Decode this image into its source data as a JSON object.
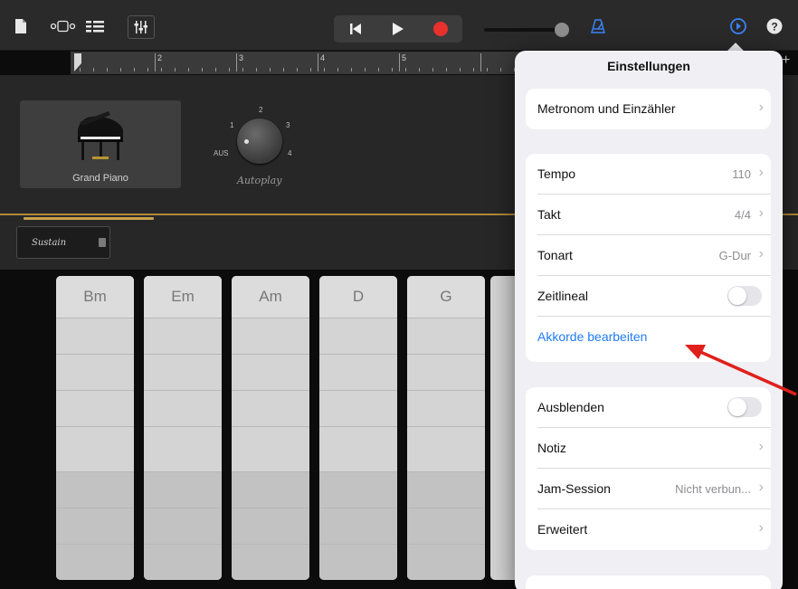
{
  "toolbar": {
    "icons": [
      "document-icon",
      "view-toggle-icon",
      "tracks-view-icon",
      "mixer-icon",
      "rewind-icon",
      "play-icon",
      "record-icon",
      "metronome-icon",
      "settings-icon",
      "help-icon"
    ],
    "accent_color": "#3a82f7",
    "record_color": "#e8302d"
  },
  "ruler": {
    "bars": [
      "2",
      "3",
      "4",
      "5"
    ]
  },
  "track": {
    "instrument_name": "Grand Piano",
    "autoplay_label": "Autoplay",
    "autoplay_positions": [
      "AUS",
      "1",
      "2",
      "3",
      "4"
    ],
    "sustain_label": "Sustain"
  },
  "chords": [
    "Bm",
    "Em",
    "Am",
    "D",
    "G"
  ],
  "settings": {
    "title": "Einstellungen",
    "metronome": "Metronom und Einzähler",
    "tempo_label": "Tempo",
    "tempo_value": "110",
    "takt_label": "Takt",
    "takt_value": "4/4",
    "tonart_label": "Tonart",
    "tonart_value": "G-Dur",
    "zeitlineal_label": "Zeitlineal",
    "zeitlineal_on": false,
    "akkorde_label": "Akkorde bearbeiten",
    "ausblenden_label": "Ausblenden",
    "ausblenden_on": false,
    "notiz_label": "Notiz",
    "jam_label": "Jam-Session",
    "jam_value": "Nicht verbun...",
    "erweitert_label": "Erweitert"
  },
  "annotation_color": "#e0201c"
}
